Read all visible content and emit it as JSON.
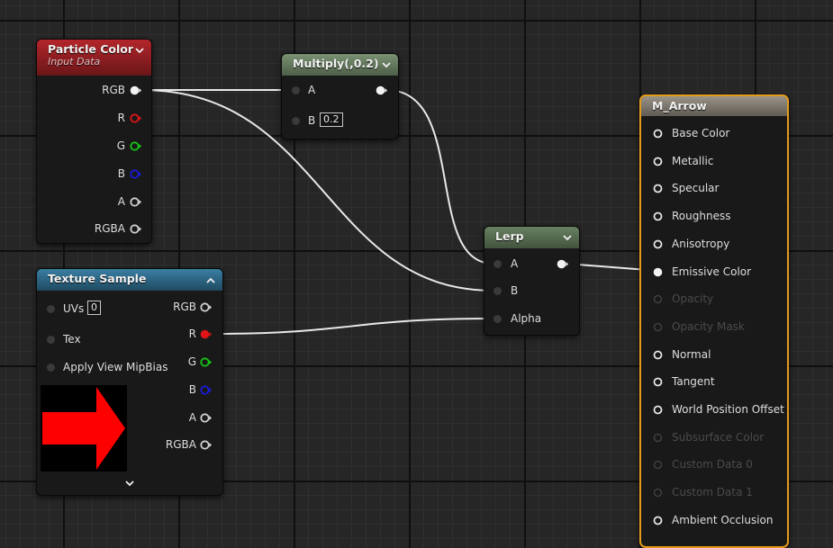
{
  "nodes": {
    "particle_color": {
      "title": "Particle Color",
      "subtitle": "Input Data",
      "outputs": [
        "RGB",
        "R",
        "G",
        "B",
        "A",
        "RGBA"
      ]
    },
    "multiply": {
      "title": "Multiply(,0.2)",
      "input_a": "A",
      "input_b": "B",
      "b_value": "0.2"
    },
    "texture_sample": {
      "title": "Texture Sample",
      "inputs": [
        "UVs",
        "Tex",
        "Apply View MipBias"
      ],
      "uvs_value": "0",
      "outputs": [
        "RGB",
        "R",
        "G",
        "B",
        "A",
        "RGBA"
      ]
    },
    "lerp": {
      "title": "Lerp",
      "inputs": [
        "A",
        "B",
        "Alpha"
      ]
    },
    "material": {
      "title": "M_Arrow",
      "inputs": [
        "Base Color",
        "Metallic",
        "Specular",
        "Roughness",
        "Anisotropy",
        "Emissive Color",
        "Opacity",
        "Opacity Mask",
        "Normal",
        "Tangent",
        "World Position Offset",
        "Subsurface Color",
        "Custom Data 0",
        "Custom Data 1",
        "Ambient Occlusion"
      ],
      "disabled": [
        6,
        7,
        11,
        12,
        13
      ]
    }
  },
  "colors": {
    "particle_header": "#b3262b",
    "multiply_header": "#6e8466",
    "lerp_header": "#5c7356",
    "texture_header": "#2f6d8c",
    "material_header": "#8a8377",
    "material_border": "#e39b1a",
    "wire": "#e8e8e8",
    "pin_red": "#e01515",
    "pin_green": "#16c516",
    "pin_blue": "#1a1ad8",
    "pin_white": "#f2f2f2",
    "arrow": "#ff0000"
  },
  "icons": {
    "collapse": "chevron-down-icon",
    "expand": "chevron-up-icon",
    "output_pin": "pin-arrow-icon",
    "input_pin": "pin-dot-icon",
    "preview": "arrow-thumbnail-icon"
  }
}
